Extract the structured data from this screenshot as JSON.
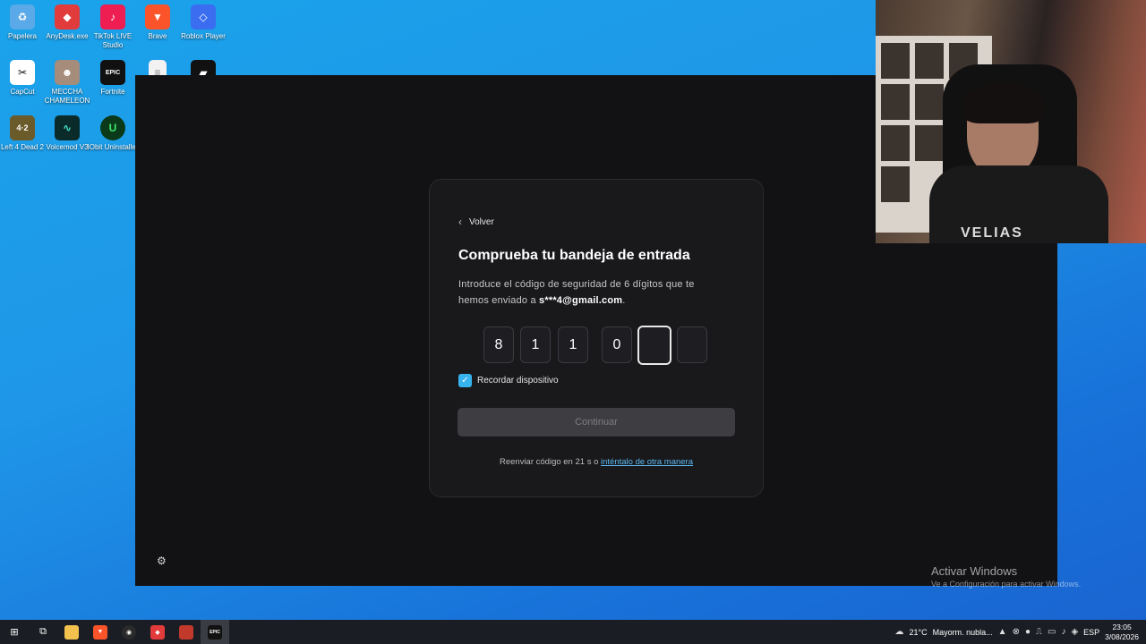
{
  "desktop_icons": [
    {
      "label": "Papelera",
      "icon": "recycle-bin-icon",
      "color": "#3b8fd6"
    },
    {
      "label": "AnyDesk.exe",
      "icon": "anydesk-icon",
      "color": "#e23b3b"
    },
    {
      "label": "TikTok LIVE Studio",
      "icon": "tiktok-icon",
      "color": "#ee1d52"
    },
    {
      "label": "Brave",
      "icon": "brave-icon",
      "color": "#fb542b"
    },
    {
      "label": "Roblox Player",
      "icon": "roblox-icon",
      "color": "#3a6df0"
    },
    {
      "label": "CapCut",
      "icon": "capcut-icon",
      "color": "#ffffff"
    },
    {
      "label": "MECCHA CHAMELEON",
      "icon": "meccha-chameleon-icon",
      "color": "#a68c7a"
    },
    {
      "label": "Fortnite",
      "icon": "epic-games-icon",
      "color": "#111111"
    },
    {
      "label": "",
      "icon": "document-icon",
      "color": "#f2f2f2"
    },
    {
      "label": "",
      "icon": "roblox-studio-icon",
      "color": "#111111"
    },
    {
      "label": "Left 4 Dead 2",
      "icon": "left4dead2-icon",
      "color": "#6b5a2a"
    },
    {
      "label": "Voicemod V3",
      "icon": "voicemod-icon",
      "color": "#0b2b2b"
    },
    {
      "label": "IObit Uninstaller",
      "icon": "iobit-icon",
      "color": "#0a3a1a"
    }
  ],
  "dialog": {
    "back_label": "Volver",
    "title": "Comprueba tu bandeja de entrada",
    "description": "Introduce el código de seguridad de 6 dígitos que te hemos enviado a",
    "email": "s***4@gmail.com",
    "digits": [
      "8",
      "1",
      "1",
      "0",
      "",
      ""
    ],
    "remember_label": "Recordar dispositivo",
    "remember_checked": true,
    "continue_label": "Continuar",
    "resend_text": "Reenviar código en 21 s o",
    "alt_link": "inténtalo de otra manera"
  },
  "watermark": {
    "title": "Activar Windows",
    "subtitle": "Ve a Configuración para activar Windows."
  },
  "taskbar": {
    "weather_temp": "21°C",
    "weather_desc": "Mayorm. nubla...",
    "language": "ESP",
    "time": "23:05",
    "date": "3/08/2026"
  },
  "webcam": {
    "shirt_text": "VELIAS"
  },
  "colors": {
    "accent_blue": "#37b3ee",
    "link_blue": "#5bb7ef",
    "window_bg": "#121214",
    "dialog_bg": "#19191c"
  }
}
